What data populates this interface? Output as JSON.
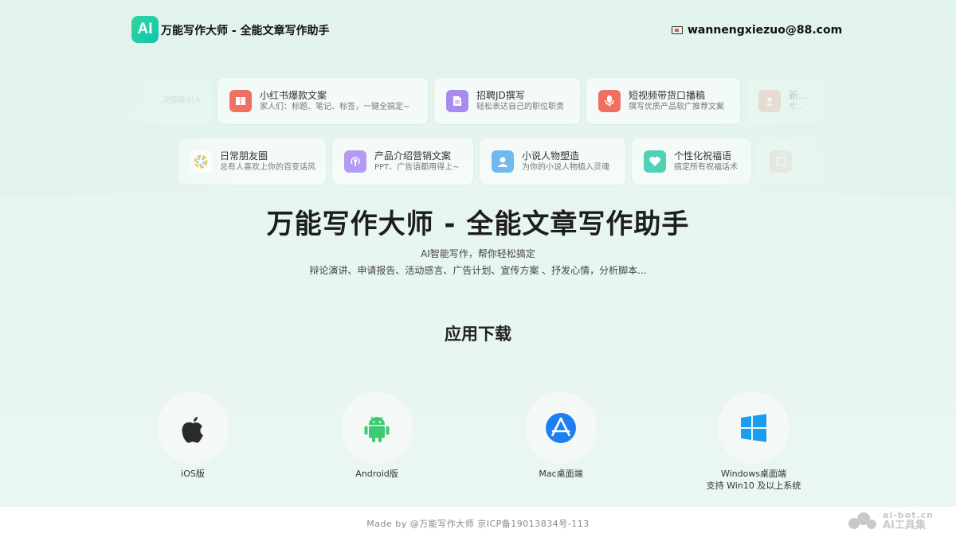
{
  "header": {
    "logo_text": "AI",
    "title": "万能写作大师 - 全能文章写作助手",
    "email_icon": "mail-icon",
    "email": "wannengxiezuo@88.com"
  },
  "cards_row1": [
    {
      "title": "",
      "sub": "决策吸引人",
      "icon": "partial-icon",
      "color": "#dfe9e4"
    },
    {
      "title": "小红书爆款文案",
      "sub": "家人们：标题、笔记、标签，一键全搞定~",
      "icon": "book-icon",
      "color": "#f06e62"
    },
    {
      "title": "招聘JD撰写",
      "sub": "轻松表达自己的职位职责",
      "icon": "document-icon",
      "color": "#a98bf0"
    },
    {
      "title": "短视频带货口播稿",
      "sub": "撰写优质产品软广推荐文案",
      "icon": "microphone-icon",
      "color": "#f06e62"
    },
    {
      "title": "新...",
      "sub": "专...",
      "icon": "person-icon",
      "color": "#f29b92"
    }
  ],
  "cards_row2": [
    {
      "title": "日常朋友圈",
      "sub": "总有人喜欢上你的百变话风",
      "icon": "aperture-icon",
      "color": "#ffffff"
    },
    {
      "title": "产品介绍营销文案",
      "sub": "PPT、广告语都用得上~",
      "icon": "podcast-icon",
      "color": "#b49af5"
    },
    {
      "title": "小说人物塑造",
      "sub": "为你的小说人物植入灵魂",
      "icon": "user-icon",
      "color": "#6fb8f0"
    },
    {
      "title": "个性化祝福语",
      "sub": "搞定所有祝福话术",
      "icon": "heart-icon",
      "color": "#4fd2b5"
    },
    {
      "title": "",
      "sub": "",
      "icon": "frame-icon",
      "color": "#e8b4ae"
    }
  ],
  "hero": {
    "title": "万能写作大师 - 全能文章写作助手",
    "subtitle1": "AI智能写作，帮你轻松搞定",
    "subtitle2": "辩论演讲、申请报告、活动感言、广告计划、宣传方案 、抒发心情，分析脚本..."
  },
  "download": {
    "heading": "应用下载",
    "items": [
      {
        "label": "iOS版",
        "icon": "apple-icon"
      },
      {
        "label": "Android版",
        "icon": "android-icon"
      },
      {
        "label": "Mac桌面端",
        "icon": "app-store-icon"
      },
      {
        "label": "Windows桌面端",
        "label2": "支持 Win10 及以上系统",
        "icon": "windows-icon"
      }
    ]
  },
  "footer": {
    "text": "Made by @万能写作大师 京ICP备19013834号-113"
  },
  "watermark": {
    "line1": "ai-bot.cn",
    "line2": "AI工具集"
  }
}
